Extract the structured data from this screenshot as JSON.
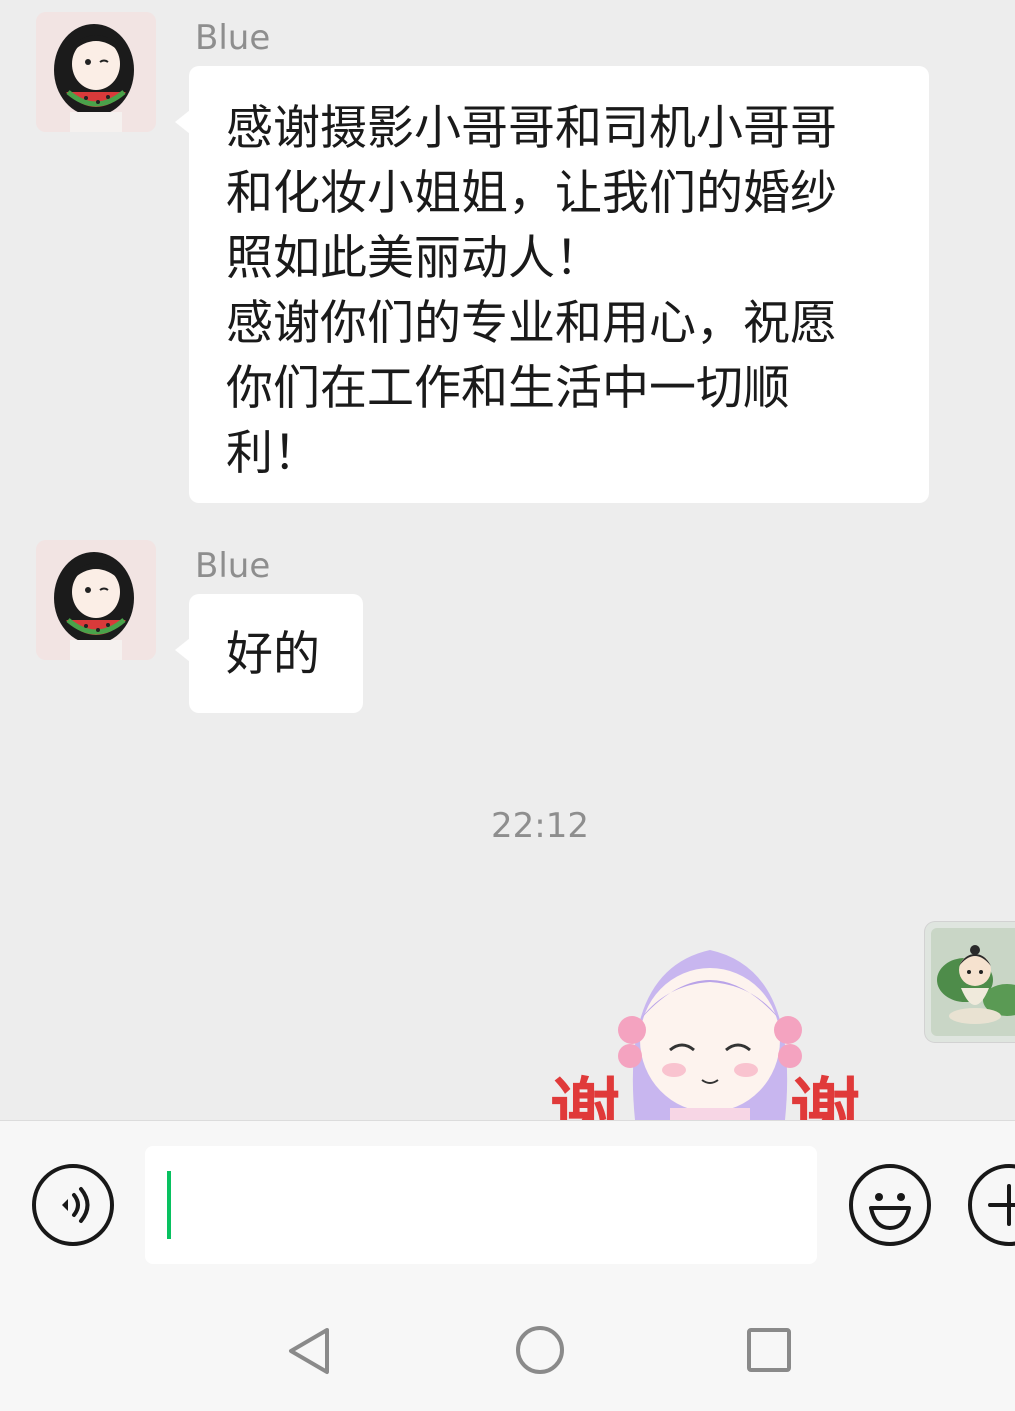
{
  "messages": [
    {
      "sender": "Blue",
      "lines": [
        "感谢摄影小哥哥和司机小哥哥",
        "和化妆小姐姐，让我们的婚纱",
        "照如此美丽动人！",
        "感谢你们的专业和用心，祝愿",
        "你们在工作和生活中一切顺",
        "利！"
      ]
    },
    {
      "sender": "Blue",
      "lines": [
        "好的"
      ]
    }
  ],
  "timestamp": "22:12",
  "sticker": {
    "text": "谢谢",
    "colors": {
      "hair": "#c8b6ef",
      "flower": "#f4a3c0",
      "text": "#e03a3a"
    }
  },
  "input": {
    "value": ""
  },
  "icons": {
    "voice": "voice-icon",
    "emoji": "emoji-icon",
    "plus": "plus-icon",
    "back": "back-nav-icon",
    "home": "home-nav-icon",
    "recents": "recents-nav-icon"
  },
  "colors": {
    "background": "#ededed",
    "bubble": "#ffffff",
    "caret": "#08c160",
    "meta_text": "#8e8e8e"
  }
}
